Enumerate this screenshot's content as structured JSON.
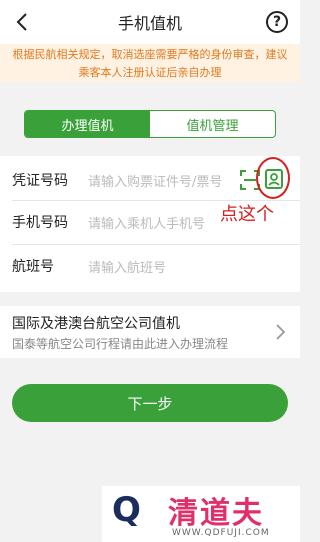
{
  "header": {
    "title": "手机值机"
  },
  "notice": {
    "text": "根据民航相关规定，取消选座需要严格的身份审查，建议乘客本人注册认证后亲自办理"
  },
  "tabs": [
    {
      "label": "办理值机"
    },
    {
      "label": "值机管理"
    }
  ],
  "form": {
    "doc": {
      "label": "凭证号码",
      "placeholder": "请输入购票证件号/票号"
    },
    "phone": {
      "label": "手机号码",
      "placeholder": "请输入乘机人手机号"
    },
    "flight": {
      "label": "航班号",
      "placeholder": "请输入航班号"
    }
  },
  "annotation": {
    "text": "点这个"
  },
  "intl": {
    "title": "国际及港澳台航空公司值机",
    "subtitle": "国泰等航空公司行程请由此进入办理流程"
  },
  "next_button": {
    "label": "下一步"
  },
  "watermark": {
    "brand": "清道夫",
    "url": "WWW.QDFUJI.COM"
  },
  "colors": {
    "accent": "#3aa13a",
    "notice_bg": "#fff2e3",
    "notice_text": "#e07a1f",
    "annotation": "#d42020"
  }
}
